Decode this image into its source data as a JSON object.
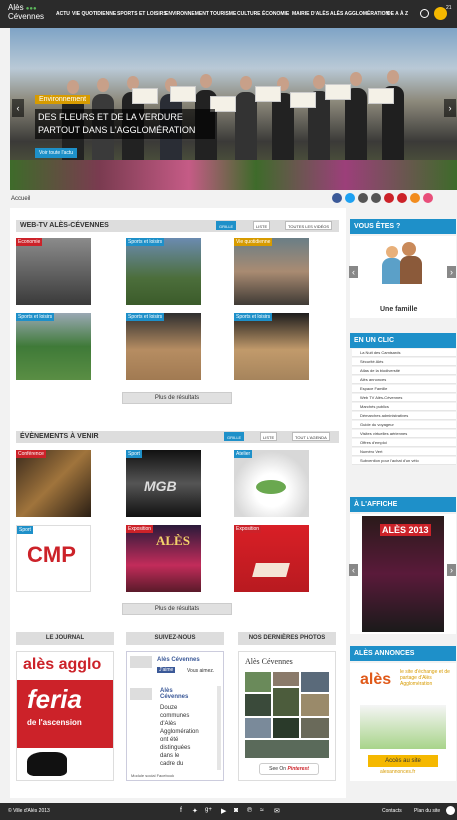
{
  "logo": {
    "line1": "Alès",
    "line2": "Cévennes"
  },
  "nav": [
    "ACTU",
    "VIE QUOTIDIENNE",
    "SPORTS ET LOISIRS",
    "ENVIRONNEMENT",
    "TOURISME",
    "CULTURE",
    "ÉCONOMIE",
    "MAIRIE D'ALÈS",
    "ALÈS AGGLOMÉRATION",
    "DE A À Z"
  ],
  "weather_temp": "21",
  "hero": {
    "tag": "Environnement",
    "title": "DES FLEURS ET DE LA VERDURE PARTOUT DANS L'AGGLOMÉRATION",
    "button": "Voir toute l'actu"
  },
  "breadcrumb": "Accueil",
  "social_icons": [
    "facebook-icon",
    "twitter-icon",
    "google-plus-icon",
    "youtube-icon",
    "instagram-icon",
    "pinterest-icon",
    "rss-icon",
    "mail-icon"
  ],
  "colors": {
    "accent": "#1e90c9",
    "tag_orange": "#d79b00",
    "tag_red": "#cc2229",
    "dark": "#2b2b2b"
  },
  "webtv": {
    "title": "WEB-TV ALÈS-CÉVENNES",
    "views": [
      "GRILLE",
      "LISTE",
      "TOUTES LES VIDÉOS"
    ],
    "items": [
      {
        "label": "Economie"
      },
      {
        "label": "Sports et loisirs"
      },
      {
        "label": "Vie quotidienne"
      },
      {
        "label": "Sports et loisirs"
      },
      {
        "label": "Sports et loisirs"
      },
      {
        "label": "Sports et loisirs"
      }
    ],
    "more": "Plus de résultats"
  },
  "events": {
    "title": "ÉVÈNEMENTS À VENIR",
    "views": [
      "GRILLE",
      "LISTE",
      "TOUT L'AGENDA"
    ],
    "items": [
      {
        "label": "Conférence",
        "text": ""
      },
      {
        "label": "Sport",
        "text": "MGB"
      },
      {
        "label": "Atelier",
        "text": ""
      },
      {
        "label": "Sport",
        "text": "CMP"
      },
      {
        "label": "Exposition",
        "text": "ALÈS"
      },
      {
        "label": "Exposition",
        "text": ""
      }
    ],
    "more": "Plus de résultats"
  },
  "sidebar": {
    "vous_etes": {
      "title": "VOUS ÊTES ?",
      "caption": "Une famille"
    },
    "en_un_clic": {
      "title": "EN UN CLIC",
      "items": [
        "La Nuit des Camisards",
        "Sécurité Alès",
        "Atlas de la biodiversité",
        "Alès annonces",
        "Espace Famille",
        "Web TV Alès-Cévennes",
        "Marchés publics",
        "Démarches administratives",
        "Guide du voyageur",
        "Visites virtuelles aériennes",
        "Offres d'emploi",
        "Numéro Vert",
        "Subvention pour l'achat d'un vélo"
      ]
    },
    "affiche": {
      "title": "À L'AFFICHE",
      "poster_text": "ALÈS 2013"
    },
    "annonces": {
      "title": "ALÈS ANNONCES",
      "logo": "alès",
      "tagline": "le site d'échange et de partage d'Alès Agglomération",
      "button": "Accès au site",
      "url": "alesannonces.fr"
    }
  },
  "bottom": {
    "journal": {
      "title": "LE JOURNAL",
      "brand": "alès agglo",
      "feria": "feria",
      "ascension": "de l'ascension"
    },
    "suivez": {
      "title": "SUIVEZ-NOUS",
      "fb_name": "Alès Cévennes",
      "like": "J'aime",
      "likes_text": "Vous aimez.",
      "post_name": "Alès Cévennes",
      "post_text": "Douze communes d'Alès Agglomération ont été distinguées dans le cadre du",
      "footer": "Module social Facebook"
    },
    "photos": {
      "title": "NOS DERNIÈRES PHOTOS",
      "album": "Alès Cévennes",
      "see_on": "See On",
      "pinterest": "Pinterest"
    }
  },
  "footer": {
    "copyright": "© Ville d'Alès 2013",
    "links": [
      "Contacts",
      "Plan du site"
    ]
  }
}
